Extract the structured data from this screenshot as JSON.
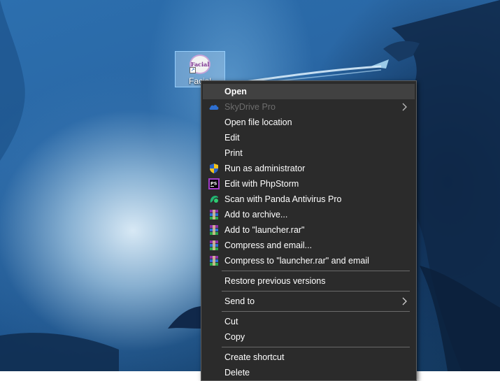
{
  "desktop": {
    "icon": {
      "label": "Facial",
      "art_text": "Facial"
    }
  },
  "context_menu": {
    "items": [
      {
        "label": "Open",
        "icon": "none",
        "bold": true
      },
      {
        "label": "SkyDrive Pro",
        "icon": "cloud-icon",
        "disabled": true,
        "submenu": true
      },
      {
        "label": "Open file location",
        "icon": "none"
      },
      {
        "label": "Edit",
        "icon": "none"
      },
      {
        "label": "Print",
        "icon": "none"
      },
      {
        "label": "Run as administrator",
        "icon": "shield-icon"
      },
      {
        "label": "Edit with PhpStorm",
        "icon": "phpstorm-icon"
      },
      {
        "label": "Scan with Panda Antivirus Pro",
        "icon": "panda-icon"
      },
      {
        "label": "Add to archive...",
        "icon": "winrar-icon"
      },
      {
        "label": "Add to \"launcher.rar\"",
        "icon": "winrar-icon"
      },
      {
        "label": "Compress and email...",
        "icon": "winrar-icon"
      },
      {
        "label": "Compress to \"launcher.rar\" and email",
        "icon": "winrar-icon"
      },
      {
        "label": "Restore previous versions",
        "icon": "none"
      },
      {
        "label": "Send to",
        "icon": "none",
        "submenu": true
      },
      {
        "label": "Cut",
        "icon": "none"
      },
      {
        "label": "Copy",
        "icon": "none"
      },
      {
        "label": "Create shortcut",
        "icon": "none"
      },
      {
        "label": "Delete",
        "icon": "none"
      }
    ]
  },
  "colors": {
    "menu_bg": "#2b2b2b",
    "menu_hover": "#414141",
    "menu_separator": "#6a6a6a",
    "disabled_text": "#6d6d6d"
  }
}
